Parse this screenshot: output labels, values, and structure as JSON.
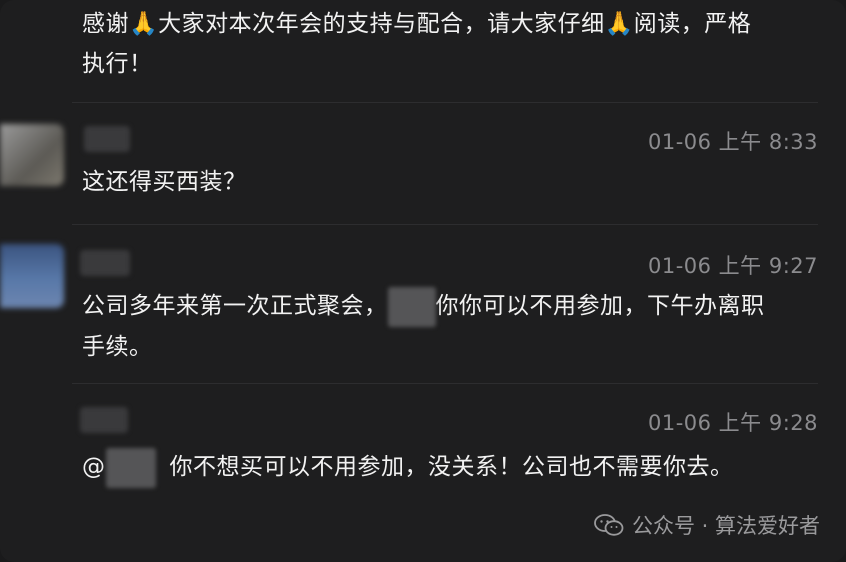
{
  "messages": [
    {
      "lines": [
        "感谢🙏大家对本次年会的支持与配合，请大家仔细🙏阅读，严格",
        "执行！"
      ]
    },
    {
      "time": "01-06 上午 8:33",
      "text": "这还得买西装？"
    },
    {
      "time": "01-06 上午 9:27",
      "text_before": "公司多年来第一次正式聚会，",
      "text_after": "你你可以不用参加，下午办离职",
      "line2": "手续。"
    },
    {
      "time": "01-06 上午 9:28",
      "mention_prefix": "@",
      "text": "你不想买可以不用参加，没关系！公司也不需要你去。"
    }
  ],
  "watermark": {
    "text": "公众号 · 算法爱好者",
    "icon": "wechat-icon"
  }
}
